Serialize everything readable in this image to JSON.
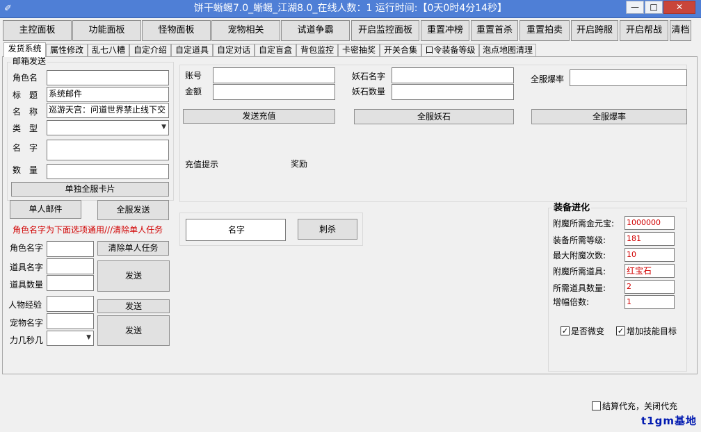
{
  "window": {
    "title": "饼干蜥蜴7.0_蜥蜴_江湖8.0_在线人数：1  运行时间:【0天0时4分14秒】",
    "min_label": "—",
    "max_label": "□",
    "close_label": "✕",
    "icon": "sword-icon"
  },
  "toolbar": [
    "主控面板",
    "功能面板",
    "怪物面板",
    "宠物相关",
    "试道争霸",
    "开启监控面板",
    "重置冲榜",
    "重置首杀",
    "重置拍卖",
    "开启跨服",
    "开启帮战",
    "清档"
  ],
  "tabs": [
    "发货系统",
    "属性修改",
    "乱七八糟",
    "自定介绍",
    "自定道具",
    "自定对话",
    "自定盲盒",
    "背包监控",
    "卡密抽奖",
    "开关合集",
    "口令装备等级",
    "泡点地图清理"
  ],
  "mail": {
    "group_title": "邮箱发送",
    "role_name_label": "角色名",
    "role_name_value": "",
    "title_label": "标　题",
    "title_value": "系统邮件",
    "name_label": "名　称",
    "name_value": "巡游天宫：问道世界禁止线下交",
    "type_label": "类　型",
    "type_value": "",
    "item_name_label": "名　字",
    "item_name_value": "",
    "quantity_label": "数　量",
    "quantity_value": "",
    "single_card_btn": "单独全服卡片",
    "single_mail_btn": "单人邮件",
    "all_send_btn": "全服发送",
    "notice": "角色名字为下面选项通用///清除单人任务"
  },
  "lower": {
    "role_name_label": "角色名字",
    "role_name_value": "",
    "clear_task_btn": "清除单人任务",
    "item_name_label": "道具名字",
    "item_name_value": "",
    "item_qty_label": "道具数量",
    "item_qty_value": "",
    "send_btn_1": "发送",
    "exp_label": "人物经验",
    "exp_value": "",
    "send_btn_2": "发送",
    "pet_name_label": "宠物名字",
    "pet_name_value": "",
    "attr_label": "力几秒几",
    "attr_value": "",
    "send_btn_3": "发送"
  },
  "recharge": {
    "account_label": "账号",
    "account_value": "",
    "amount_label": "金额",
    "amount_value": "",
    "stone_name_label": "妖石名字",
    "stone_name_value": "",
    "stone_qty_label": "妖石数量",
    "stone_qty_value": "",
    "droprate_label": "全服爆率",
    "droprate_value": "",
    "send_recharge_btn": "发送充值",
    "all_stone_btn": "全服妖石",
    "all_droprate_btn": "全服爆率",
    "tip_label": "充值提示",
    "reward_label": "奖励"
  },
  "kill": {
    "name_value": "名字",
    "kill_btn": "刺杀"
  },
  "equip": {
    "group_title": "装备进化",
    "rows": [
      {
        "label": "附魔所需金元宝:",
        "value": "1000000"
      },
      {
        "label": "装备所需等级:",
        "value": "181"
      },
      {
        "label": "最大附魔次数:",
        "value": "10"
      },
      {
        "label": "附魔所需道具:",
        "value": "红宝石"
      },
      {
        "label": "所需道具数量:",
        "value": "2"
      },
      {
        "label": "增幅倍数:",
        "value": "1"
      }
    ],
    "chk_micro_label": "是否微变",
    "chk_micro": true,
    "chk_skill_label": "增加技能目标",
    "chk_skill": true
  },
  "footer": {
    "settle_label": "结算代充，关闭代充",
    "settle_checked": false,
    "watermark": "t1gm基地"
  }
}
